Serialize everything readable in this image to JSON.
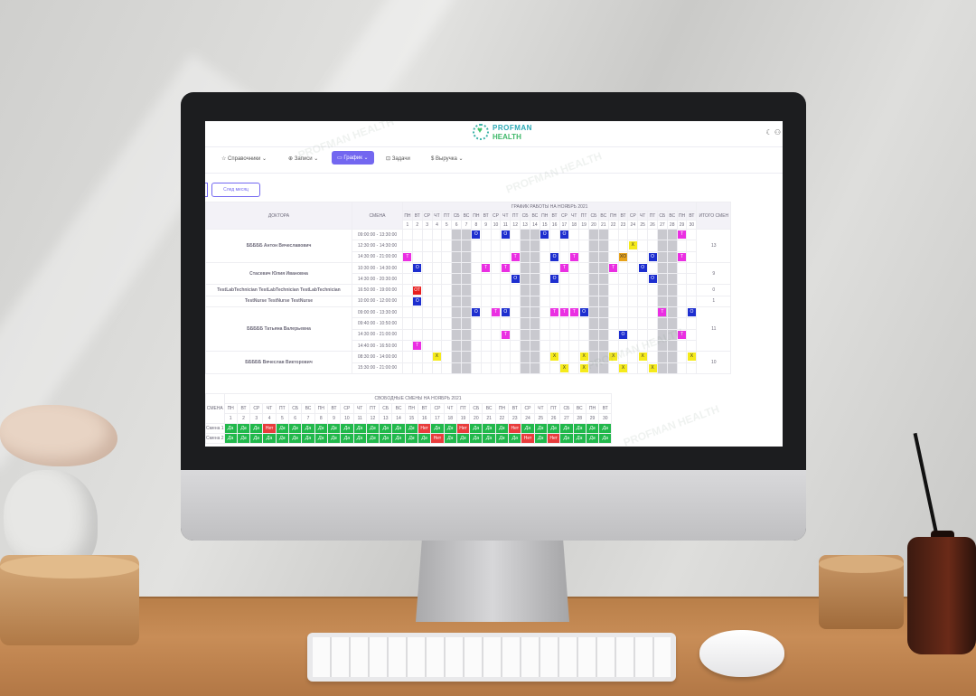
{
  "logo": {
    "line1": "PROFMAN",
    "line2": "HEALTH"
  },
  "nav": [
    {
      "label": "☆ Справочники ⌄"
    },
    {
      "label": "⊕ Записи ⌄"
    },
    {
      "label": "▭ График ⌄"
    },
    {
      "label": "⊡ Задачи"
    },
    {
      "label": "$ Выручка ⌄"
    }
  ],
  "next_button": "След месяц",
  "schedule": {
    "title": "ГРАФИК РАБОТЫ НА НОЯБРЬ 2021",
    "col_doctor": "ДОКТОРА",
    "col_shift": "СМЕНА",
    "col_total": "ИТОГО СМЕН",
    "weekdays": [
      "ПН",
      "ВТ",
      "СР",
      "ЧТ",
      "ПТ",
      "СБ",
      "ВС",
      "ПН",
      "ВТ",
      "СР",
      "ЧТ",
      "ПТ",
      "СБ",
      "ВС",
      "ПН",
      "ВТ",
      "СР",
      "ЧТ",
      "ПТ",
      "СБ",
      "ВС",
      "ПН",
      "ВТ",
      "СР",
      "ЧТ",
      "ПТ",
      "СБ",
      "ВС",
      "ПН",
      "ВТ"
    ],
    "days": [
      "1",
      "2",
      "3",
      "4",
      "5",
      "6",
      "7",
      "8",
      "9",
      "10",
      "11",
      "12",
      "13",
      "14",
      "15",
      "16",
      "17",
      "18",
      "19",
      "20",
      "21",
      "22",
      "23",
      "24",
      "25",
      "26",
      "27",
      "28",
      "29",
      "30"
    ],
    "grey_days": [
      6,
      7,
      13,
      14,
      20,
      21,
      27,
      28
    ],
    "rows": [
      {
        "doctor": "БББББ Антон Вячеславович",
        "span": 3,
        "total": "13",
        "shift": "09:00:00 - 13:30:00",
        "marks": {
          "8": "O",
          "11": "O",
          "15": "O",
          "17": "O",
          "29": "T"
        }
      },
      {
        "shift": "12:30:00 - 14:30:00",
        "marks": {
          "24": "X"
        }
      },
      {
        "shift": "14:30:00 - 21:00:00",
        "marks": {
          "1": "T",
          "12": "T",
          "16": "O",
          "18": "T",
          "23": "XO",
          "26": "O",
          "29": "T"
        }
      },
      {
        "doctor": "Стасевич Юлия Ивановна",
        "span": 2,
        "total": "9",
        "shift": "10:30:00 - 14:30:00",
        "marks": {
          "2": "O",
          "9": "T",
          "11": "T",
          "17": "T",
          "22": "T",
          "25": "O"
        }
      },
      {
        "shift": "14:30:00 - 20:30:00",
        "marks": {
          "12": "O",
          "16": "O",
          "26": "O"
        }
      },
      {
        "doctor": "TestLabTechnician TestLabTechnician TestLabTechnician",
        "span": 1,
        "total": "0",
        "shift": "16:50:00 - 19:00:00",
        "marks": {
          "2": "OT"
        }
      },
      {
        "doctor": "TestNurse TestNurse TestNurse",
        "span": 1,
        "total": "1",
        "shift": "10:00:00 - 12:00:00",
        "marks": {
          "2": "O"
        }
      },
      {
        "doctor": "БББББ Татьяна Валерьевна",
        "span": 4,
        "total": "11",
        "shift": "09:00:00 - 13:30:00",
        "marks": {
          "8": "O",
          "10": "T",
          "11": "O",
          "16": "T",
          "17": "T",
          "18": "T",
          "19": "O",
          "27": "T",
          "30": "O"
        }
      },
      {
        "shift": "09:40:00 - 10:50:00",
        "marks": {}
      },
      {
        "shift": "14:30:00 - 21:00:00",
        "marks": {
          "11": "T",
          "23": "O",
          "29": "T"
        }
      },
      {
        "shift": "14:40:00 - 16:50:00",
        "marks": {
          "2": "T"
        }
      },
      {
        "doctor": "БББББ Вячеслав Викторович",
        "span": 2,
        "total": "10",
        "shift": "08:30:00 - 14:00:00",
        "marks": {
          "4": "X",
          "16": "X",
          "19": "X",
          "22": "X",
          "25": "X",
          "30": "X"
        }
      },
      {
        "shift": "15:30:00 - 21:00:00",
        "marks": {
          "17": "X",
          "19": "X",
          "23": "X",
          "26": "X"
        }
      }
    ]
  },
  "free_shifts": {
    "title": "СВОБОДНЫЕ СМЕНЫ НА НОЯБРЬ 2021",
    "col_shift": "СМЕНА",
    "weekdays": [
      "ПН",
      "ВТ",
      "СР",
      "ЧТ",
      "ПТ",
      "СБ",
      "ВС",
      "ПН",
      "ВТ",
      "СР",
      "ЧТ",
      "ПТ",
      "СБ",
      "ВС",
      "ПН",
      "ВТ",
      "СР",
      "ЧТ",
      "ПТ",
      "СБ",
      "ВС",
      "ПН",
      "ВТ",
      "СР",
      "ЧТ",
      "ПТ",
      "СБ",
      "ВС",
      "ПН",
      "ВТ"
    ],
    "days": [
      "1",
      "2",
      "3",
      "4",
      "5",
      "6",
      "7",
      "8",
      "9",
      "10",
      "11",
      "12",
      "13",
      "14",
      "15",
      "16",
      "17",
      "18",
      "19",
      "20",
      "21",
      "22",
      "23",
      "24",
      "25",
      "26",
      "27",
      "28",
      "29",
      "30"
    ],
    "rows": [
      {
        "label": "Смена 1",
        "values": [
          "Да",
          "Да",
          "Да",
          "Нет",
          "Да",
          "Да",
          "Да",
          "Да",
          "Да",
          "Да",
          "Да",
          "Да",
          "Да",
          "Да",
          "Да",
          "Нет",
          "Да",
          "Да",
          "Нет",
          "Да",
          "Да",
          "Да",
          "Нет",
          "Да",
          "Да",
          "Да",
          "Да",
          "Да",
          "Да",
          "Да"
        ]
      },
      {
        "label": "Смена 2",
        "values": [
          "Да",
          "Да",
          "Да",
          "Да",
          "Да",
          "Да",
          "Да",
          "Да",
          "Да",
          "Да",
          "Да",
          "Да",
          "Да",
          "Да",
          "Да",
          "Да",
          "Нет",
          "Да",
          "Да",
          "Да",
          "Да",
          "Да",
          "Да",
          "Нет",
          "Да",
          "Нет",
          "Да",
          "Да",
          "Да",
          "Да"
        ]
      }
    ]
  },
  "colors": {
    "O": "#1d2ecf",
    "T": "#ea2fe2",
    "X": "#f5ea1b",
    "OT": "#e82020",
    "XO": "#e7a21a",
    "yes": "#21b84b",
    "no": "#e83c3c",
    "accent": "#7367f0"
  }
}
